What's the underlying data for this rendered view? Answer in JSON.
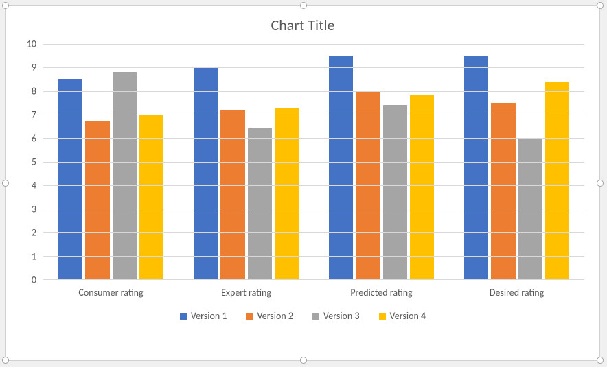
{
  "chart_data": {
    "type": "bar",
    "title": "Chart Title",
    "categories": [
      "Consumer rating",
      "Expert rating",
      "Predicted rating",
      "Desired rating"
    ],
    "series": [
      {
        "name": "Version 1",
        "color": "#4472C4",
        "values": [
          8.5,
          9.0,
          9.5,
          9.5
        ]
      },
      {
        "name": "Version 2",
        "color": "#ED7D31",
        "values": [
          6.7,
          7.2,
          8.0,
          7.5
        ]
      },
      {
        "name": "Version 3",
        "color": "#A5A5A5",
        "values": [
          8.8,
          6.4,
          7.4,
          6.0
        ]
      },
      {
        "name": "Version 4",
        "color": "#FFC000",
        "values": [
          7.0,
          7.3,
          7.8,
          8.4
        ]
      }
    ],
    "ylabel": "",
    "xlabel": "",
    "ylim": [
      0,
      10
    ],
    "y_ticks": [
      "10",
      "9",
      "8",
      "7",
      "6",
      "5",
      "4",
      "3",
      "2",
      "1",
      "0"
    ]
  }
}
